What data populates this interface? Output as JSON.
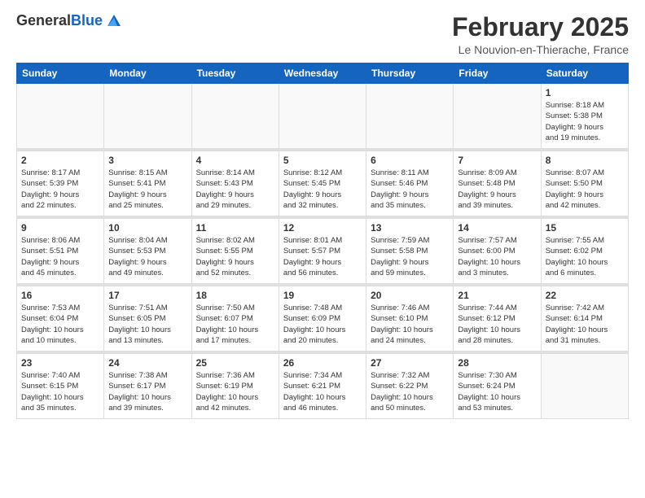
{
  "header": {
    "logo_general": "General",
    "logo_blue": "Blue",
    "month_title": "February 2025",
    "location": "Le Nouvion-en-Thierache, France"
  },
  "weekdays": [
    "Sunday",
    "Monday",
    "Tuesday",
    "Wednesday",
    "Thursday",
    "Friday",
    "Saturday"
  ],
  "weeks": [
    [
      {
        "day": "",
        "info": ""
      },
      {
        "day": "",
        "info": ""
      },
      {
        "day": "",
        "info": ""
      },
      {
        "day": "",
        "info": ""
      },
      {
        "day": "",
        "info": ""
      },
      {
        "day": "",
        "info": ""
      },
      {
        "day": "1",
        "info": "Sunrise: 8:18 AM\nSunset: 5:38 PM\nDaylight: 9 hours\nand 19 minutes."
      }
    ],
    [
      {
        "day": "2",
        "info": "Sunrise: 8:17 AM\nSunset: 5:39 PM\nDaylight: 9 hours\nand 22 minutes."
      },
      {
        "day": "3",
        "info": "Sunrise: 8:15 AM\nSunset: 5:41 PM\nDaylight: 9 hours\nand 25 minutes."
      },
      {
        "day": "4",
        "info": "Sunrise: 8:14 AM\nSunset: 5:43 PM\nDaylight: 9 hours\nand 29 minutes."
      },
      {
        "day": "5",
        "info": "Sunrise: 8:12 AM\nSunset: 5:45 PM\nDaylight: 9 hours\nand 32 minutes."
      },
      {
        "day": "6",
        "info": "Sunrise: 8:11 AM\nSunset: 5:46 PM\nDaylight: 9 hours\nand 35 minutes."
      },
      {
        "day": "7",
        "info": "Sunrise: 8:09 AM\nSunset: 5:48 PM\nDaylight: 9 hours\nand 39 minutes."
      },
      {
        "day": "8",
        "info": "Sunrise: 8:07 AM\nSunset: 5:50 PM\nDaylight: 9 hours\nand 42 minutes."
      }
    ],
    [
      {
        "day": "9",
        "info": "Sunrise: 8:06 AM\nSunset: 5:51 PM\nDaylight: 9 hours\nand 45 minutes."
      },
      {
        "day": "10",
        "info": "Sunrise: 8:04 AM\nSunset: 5:53 PM\nDaylight: 9 hours\nand 49 minutes."
      },
      {
        "day": "11",
        "info": "Sunrise: 8:02 AM\nSunset: 5:55 PM\nDaylight: 9 hours\nand 52 minutes."
      },
      {
        "day": "12",
        "info": "Sunrise: 8:01 AM\nSunset: 5:57 PM\nDaylight: 9 hours\nand 56 minutes."
      },
      {
        "day": "13",
        "info": "Sunrise: 7:59 AM\nSunset: 5:58 PM\nDaylight: 9 hours\nand 59 minutes."
      },
      {
        "day": "14",
        "info": "Sunrise: 7:57 AM\nSunset: 6:00 PM\nDaylight: 10 hours\nand 3 minutes."
      },
      {
        "day": "15",
        "info": "Sunrise: 7:55 AM\nSunset: 6:02 PM\nDaylight: 10 hours\nand 6 minutes."
      }
    ],
    [
      {
        "day": "16",
        "info": "Sunrise: 7:53 AM\nSunset: 6:04 PM\nDaylight: 10 hours\nand 10 minutes."
      },
      {
        "day": "17",
        "info": "Sunrise: 7:51 AM\nSunset: 6:05 PM\nDaylight: 10 hours\nand 13 minutes."
      },
      {
        "day": "18",
        "info": "Sunrise: 7:50 AM\nSunset: 6:07 PM\nDaylight: 10 hours\nand 17 minutes."
      },
      {
        "day": "19",
        "info": "Sunrise: 7:48 AM\nSunset: 6:09 PM\nDaylight: 10 hours\nand 20 minutes."
      },
      {
        "day": "20",
        "info": "Sunrise: 7:46 AM\nSunset: 6:10 PM\nDaylight: 10 hours\nand 24 minutes."
      },
      {
        "day": "21",
        "info": "Sunrise: 7:44 AM\nSunset: 6:12 PM\nDaylight: 10 hours\nand 28 minutes."
      },
      {
        "day": "22",
        "info": "Sunrise: 7:42 AM\nSunset: 6:14 PM\nDaylight: 10 hours\nand 31 minutes."
      }
    ],
    [
      {
        "day": "23",
        "info": "Sunrise: 7:40 AM\nSunset: 6:15 PM\nDaylight: 10 hours\nand 35 minutes."
      },
      {
        "day": "24",
        "info": "Sunrise: 7:38 AM\nSunset: 6:17 PM\nDaylight: 10 hours\nand 39 minutes."
      },
      {
        "day": "25",
        "info": "Sunrise: 7:36 AM\nSunset: 6:19 PM\nDaylight: 10 hours\nand 42 minutes."
      },
      {
        "day": "26",
        "info": "Sunrise: 7:34 AM\nSunset: 6:21 PM\nDaylight: 10 hours\nand 46 minutes."
      },
      {
        "day": "27",
        "info": "Sunrise: 7:32 AM\nSunset: 6:22 PM\nDaylight: 10 hours\nand 50 minutes."
      },
      {
        "day": "28",
        "info": "Sunrise: 7:30 AM\nSunset: 6:24 PM\nDaylight: 10 hours\nand 53 minutes."
      },
      {
        "day": "",
        "info": ""
      }
    ]
  ]
}
